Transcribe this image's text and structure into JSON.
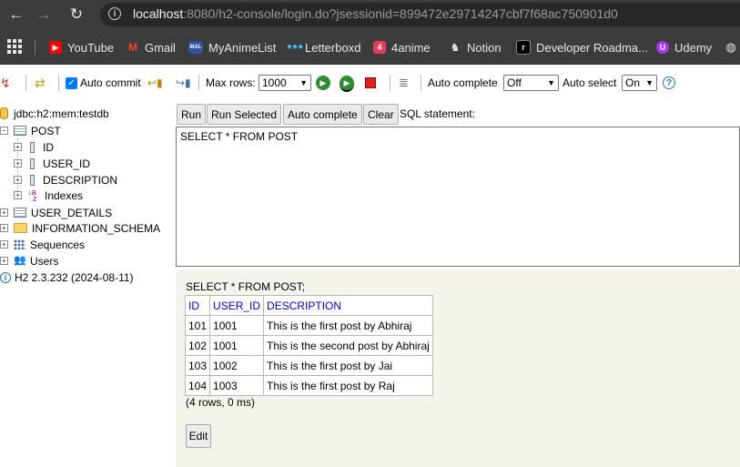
{
  "browser": {
    "url_host": "localhost",
    "url_rest": ":8080/h2-console/login.do?jsessionid=899472e29714247cbf7f68ac750901d0",
    "bookmarks": [
      {
        "label": "YouTube",
        "icon": "youtube-icon",
        "color": "#ff0000"
      },
      {
        "label": "Gmail",
        "icon": "gmail-icon",
        "color": "#ea4335"
      },
      {
        "label": "MyAnimeList",
        "icon": "myanimelist-icon",
        "color": "#2e51a2"
      },
      {
        "label": "Letterboxd",
        "icon": "letterboxd-icon",
        "color": "#00c030"
      },
      {
        "label": "4anime",
        "icon": "4anime-icon",
        "color": "#e83b5a"
      },
      {
        "label": "Notion",
        "icon": "notion-icon",
        "color": "#ffffff"
      },
      {
        "label": "Developer Roadma...",
        "icon": "roadmap-icon",
        "color": "#000000"
      },
      {
        "label": "Udemy",
        "icon": "udemy-icon",
        "color": "#a435f0"
      }
    ]
  },
  "toolbar": {
    "auto_commit_label": "Auto commit",
    "max_rows_label": "Max rows:",
    "max_rows_value": "1000",
    "auto_complete_label": "Auto complete",
    "auto_complete_value": "Off",
    "auto_select_label": "Auto select",
    "auto_select_value": "On"
  },
  "tree": {
    "connection": "jdbc:h2:mem:testdb",
    "table_post": "POST",
    "columns": [
      "ID",
      "USER_ID",
      "DESCRIPTION"
    ],
    "indexes": "Indexes",
    "table_user_details": "USER_DETAILS",
    "information_schema": "INFORMATION_SCHEMA",
    "sequences": "Sequences",
    "users": "Users",
    "version": "H2 2.3.232 (2024-08-11)"
  },
  "editor": {
    "run": "Run",
    "run_selected": "Run Selected",
    "auto_complete": "Auto complete",
    "clear": "Clear",
    "sql_label": "SQL statement:",
    "sql_text": "SELECT * FROM POST"
  },
  "result": {
    "executed_sql": "SELECT * FROM POST;",
    "headers": [
      "ID",
      "USER_ID",
      "DESCRIPTION"
    ],
    "rows": [
      [
        "101",
        "1001",
        "This is the first post by Abhiraj"
      ],
      [
        "102",
        "1001",
        "This is the second post by Abhiraj"
      ],
      [
        "103",
        "1002",
        "This is the first post by Jai"
      ],
      [
        "104",
        "1003",
        "This is the first post by Raj"
      ]
    ],
    "summary": "(4 rows, 0 ms)",
    "edit": "Edit"
  }
}
